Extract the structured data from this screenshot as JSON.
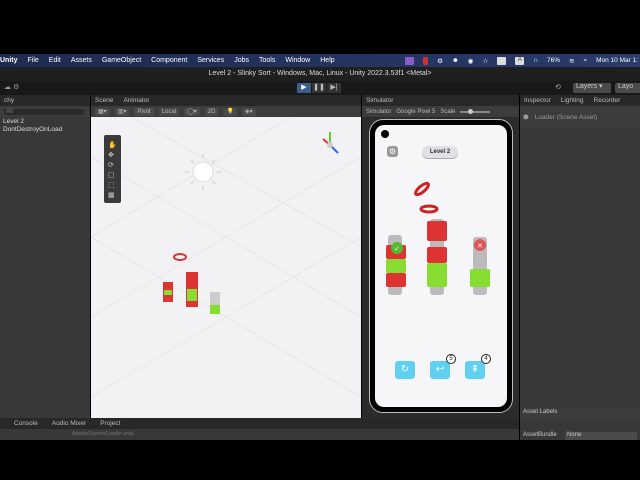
{
  "menubar": {
    "app": "Unity",
    "items": [
      "File",
      "Edit",
      "Assets",
      "GameObject",
      "Component",
      "Services",
      "Jobs",
      "Tools",
      "Window",
      "Help"
    ],
    "battery": "76%",
    "datetime": "Mon 10 Mar 1:"
  },
  "window": {
    "title": "Level 2 - Slinky Sort - Windows, Mac, Linux - Unity 2022.3.53f1 <Metal>"
  },
  "toolbar": {
    "layers": "Layers",
    "layout": "Layo"
  },
  "hierarchy": {
    "tab": "chy",
    "search": "All",
    "items": [
      "Level 2",
      "DontDestroyOnLoad"
    ]
  },
  "scene": {
    "tabs": [
      "Scene",
      "Animator"
    ],
    "pivot": "Pivot",
    "local": "Local",
    "mode2d": "2D"
  },
  "simulator": {
    "tab": "Simulator",
    "mode": "Simulator",
    "device": "Google Pixel 5",
    "scale_label": "Scale",
    "level": "Level 2",
    "undo_count": "5",
    "add_count": "4",
    "accent": "#5fd0f0"
  },
  "inspector": {
    "tabs": [
      "Inspector",
      "Lighting",
      "Recorder"
    ],
    "asset": "Loader (Scene Asset)",
    "asset_labels": "Asset Labels",
    "assetbundle_label": "AssetBundle",
    "assetbundle_value": "None"
  },
  "bottom": {
    "tabs": [
      "Console",
      "Audio Mixer",
      "Project"
    ],
    "path": "Assets/Scenes/Loader.unity"
  }
}
